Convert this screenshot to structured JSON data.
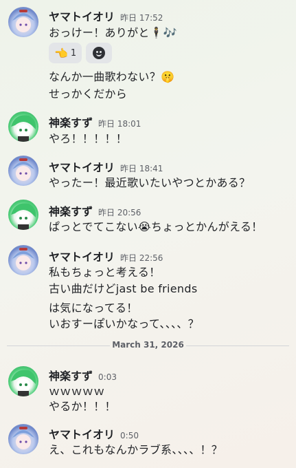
{
  "messages": [
    {
      "author": "ヤマトイオリ",
      "time": "昨日 17:52",
      "lines": [
        "おっけー！ありがと🕴🎶",
        "なんか一曲歌わない？🤫",
        "せっかくだから"
      ],
      "reactions": [
        {
          "emoji": "👈",
          "count": "1"
        }
      ]
    },
    {
      "author": "神楽すず",
      "time": "昨日 18:01",
      "lines": [
        "やろ！！！！！"
      ]
    },
    {
      "author": "ヤマトイオリ",
      "time": "昨日 18:41",
      "lines": [
        "やったー！最近歌いたいやつとかある？"
      ]
    },
    {
      "author": "神楽すず",
      "time": "昨日 20:56",
      "lines": [
        "ぱっとでてこない😭ちょっとかんがえる！"
      ]
    },
    {
      "author": "ヤマトイオリ",
      "time": "昨日 22:56",
      "lines": [
        "私もちょっと考える！",
        "古い曲だけどjast be friends",
        "は気になってる！",
        "いおすーぽいかなって、、、、？"
      ]
    },
    {
      "author": "神楽すず",
      "time": "0:03",
      "lines": [
        "ｗｗｗｗｗ",
        "やるか！！！"
      ]
    },
    {
      "author": "ヤマトイオリ",
      "time": "0:50",
      "lines": [
        "え、これもなんかラブ系、、、、！？"
      ]
    }
  ],
  "date_divider": "March 31, 2026",
  "icons": {
    "add_reaction": "smile-icon"
  }
}
